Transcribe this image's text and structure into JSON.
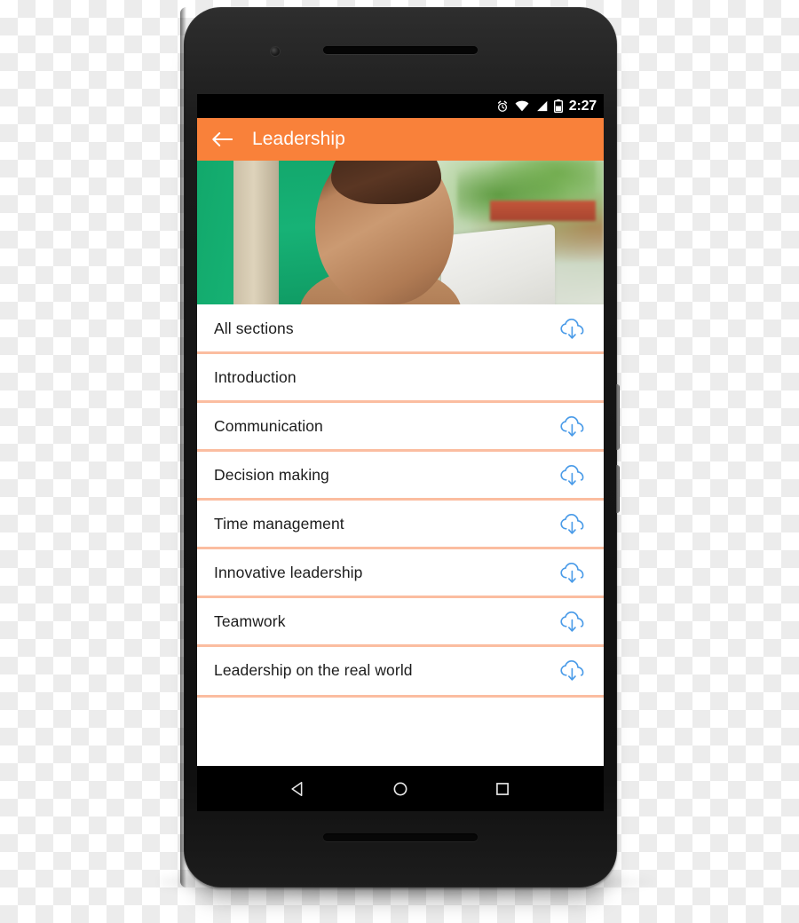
{
  "status_bar": {
    "alarm_icon": "alarm-icon",
    "wifi_icon": "wifi-icon",
    "signal_icon": "cellular-signal-icon",
    "battery_icon": "battery-icon",
    "clock": "2:27"
  },
  "app_bar": {
    "back_icon": "back-arrow-icon",
    "title": "Leadership",
    "background_color": "#F9813A"
  },
  "hero": {
    "alt": "Woman with laptop in front of green wall"
  },
  "colors": {
    "accent_orange": "#F9813A",
    "divider_peach": "#FBBDA0",
    "download_blue": "#4A9BE8",
    "text_primary": "#1C1C1C"
  },
  "list": {
    "download_icon": "cloud-download-icon",
    "rows": [
      {
        "label": "All sections",
        "downloadable": true
      },
      {
        "label": "Introduction",
        "downloadable": false
      },
      {
        "label": "Communication",
        "downloadable": true
      },
      {
        "label": "Decision making",
        "downloadable": true
      },
      {
        "label": "Time management",
        "downloadable": true
      },
      {
        "label": "Innovative leadership",
        "downloadable": true
      },
      {
        "label": "Teamwork",
        "downloadable": true
      },
      {
        "label": "Leadership on the real world",
        "downloadable": true
      }
    ]
  },
  "nav_bar": {
    "back": "nav-back-icon",
    "home": "nav-home-icon",
    "recents": "nav-recents-icon"
  },
  "device": {
    "earpiece": "earpiece-speaker",
    "camera": "front-camera",
    "power": "power-button",
    "volume": "volume-button"
  }
}
